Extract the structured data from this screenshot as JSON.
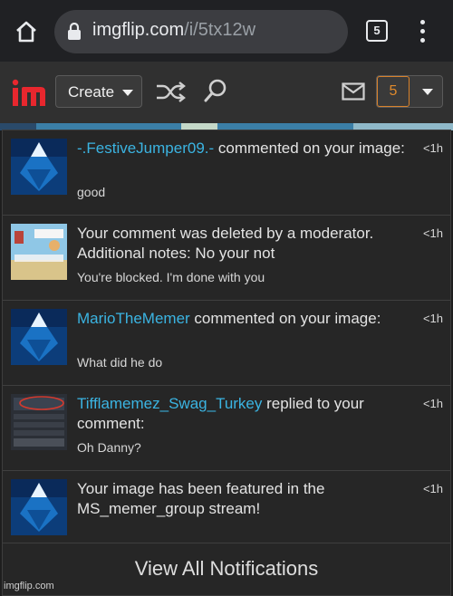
{
  "browser": {
    "url_domain": "imgflip.com",
    "url_path": "/i/5tx12w",
    "tab_count": "5"
  },
  "header": {
    "logo_text": "im",
    "create_label": "Create",
    "notification_count": "5",
    "icons": [
      "shuffle-icon",
      "search-icon",
      "mail-icon",
      "chevron-down-icon"
    ]
  },
  "notifications": [
    {
      "user": "-.FestiveJumper09.-",
      "action": " commented on your image:",
      "message": "",
      "sub": "good",
      "time": "<1h"
    },
    {
      "user": "",
      "action": "",
      "message": "Your comment was deleted by a moderator. Additional notes: No your not",
      "sub": "You're blocked. I'm done with you",
      "time": "<1h"
    },
    {
      "user": "MarioTheMemer",
      "action": " commented on your image:",
      "message": "",
      "sub": "What did he do",
      "time": "<1h"
    },
    {
      "user": "Tifflamemez_Swag_Turkey",
      "action": " replied to your comment:",
      "message": "",
      "sub": "Oh Danny?",
      "time": "<1h"
    },
    {
      "user": "",
      "action": "",
      "message": "Your image has been featured in the MS_memer_group stream!",
      "sub": "",
      "time": "<1h"
    }
  ],
  "view_all_label": "View All Notifications",
  "watermark": "imgflip.com",
  "colors": {
    "link": "#3bb4e2",
    "accent": "#e08a2c",
    "panel": "#262626"
  }
}
